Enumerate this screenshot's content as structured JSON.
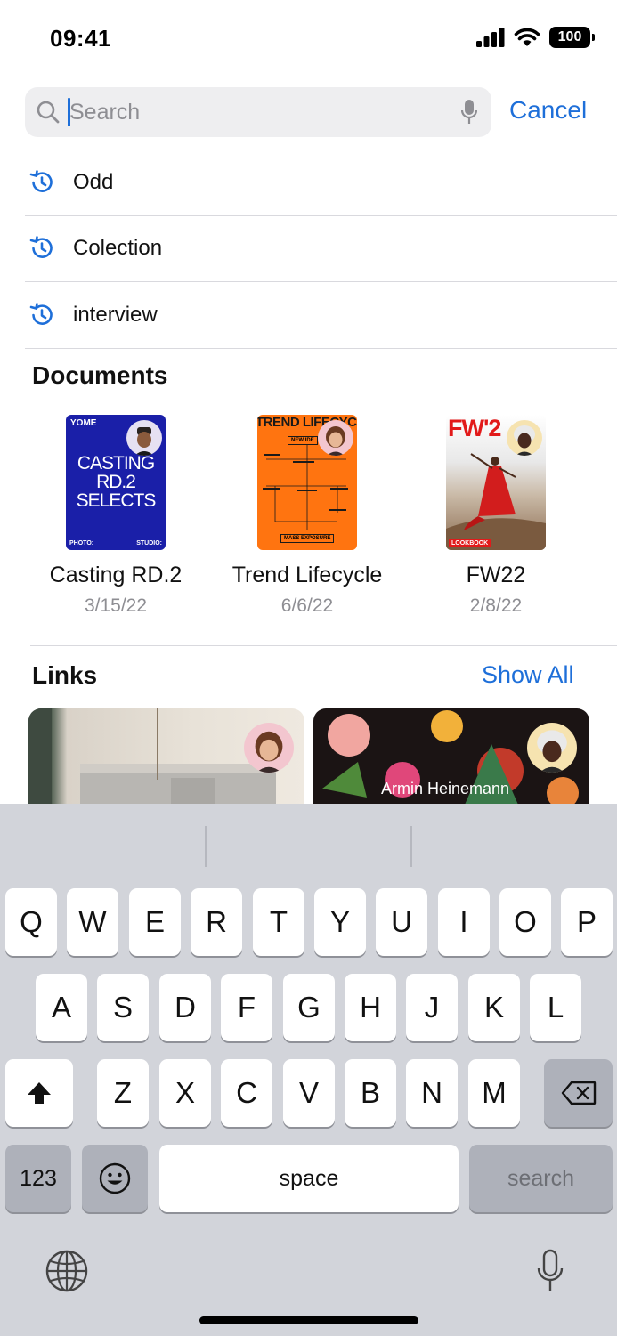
{
  "status_bar": {
    "time": "09:41",
    "battery": "100"
  },
  "search": {
    "placeholder": "Search",
    "cancel_label": "Cancel"
  },
  "recents": [
    {
      "label": "Odd"
    },
    {
      "label": "Colection"
    },
    {
      "label": "interview"
    }
  ],
  "documents": {
    "title": "Documents",
    "items": [
      {
        "name": "Casting RD.2",
        "date": "3/15/22",
        "thumb_brand": "YOME",
        "thumb_title_lines": [
          "CASTING",
          "RD.2",
          "SELECTS"
        ],
        "thumb_footer_left": "PHOTO:",
        "thumb_footer_right": "STUDIO:"
      },
      {
        "name": "Trend Lifecycle",
        "date": "6/6/22",
        "thumb_title": "TREND LIFECYC",
        "thumb_top_box": "NEW IDE",
        "thumb_bottom_box": "MASS EXPOSURE"
      },
      {
        "name": "FW22",
        "date": "2/8/22",
        "thumb_title": "FW'2",
        "thumb_tag": "LOOKBOOK"
      }
    ]
  },
  "links": {
    "title": "Links",
    "show_all_label": "Show All",
    "items": [
      {
        "caption": ""
      },
      {
        "caption": "Armin Heinemann"
      }
    ]
  },
  "keyboard": {
    "row1": [
      "Q",
      "W",
      "E",
      "R",
      "T",
      "Y",
      "U",
      "I",
      "O",
      "P"
    ],
    "row2": [
      "A",
      "S",
      "D",
      "F",
      "G",
      "H",
      "J",
      "K",
      "L"
    ],
    "row3": [
      "Z",
      "X",
      "C",
      "V",
      "B",
      "N",
      "M"
    ],
    "numbers_label": "123",
    "space_label": "space",
    "return_label": "search"
  },
  "colors": {
    "accent": "#1e6fd9",
    "keyboard_bg": "#d2d4da",
    "secondary_text": "#8e8e93"
  }
}
